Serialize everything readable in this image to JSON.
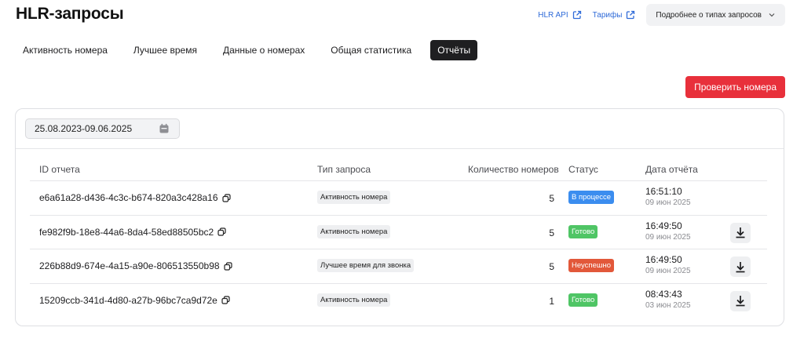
{
  "header": {
    "title": "HLR-запросы",
    "api_link": "HLR API",
    "tariffs_link": "Тарифы",
    "more_dropdown": "Подробнее о типах запросов",
    "link_color": "#2f6bd8"
  },
  "tabs": [
    {
      "label": "Активность номера",
      "active": false
    },
    {
      "label": "Лучшее время",
      "active": false
    },
    {
      "label": "Данные о номерах",
      "active": false
    },
    {
      "label": "Общая статистика",
      "active": false
    },
    {
      "label": "Отчёты",
      "active": true
    }
  ],
  "actions": {
    "check_numbers": "Проверить номера",
    "accent_color": "#e8303b"
  },
  "filter": {
    "date_range": "25.08.2023-09.06.2025",
    "icon": "calendar-icon"
  },
  "table": {
    "columns": {
      "id": "ID отчета",
      "type": "Тип запроса",
      "count": "Количество номеров",
      "status": "Статус",
      "date": "Дата отчёта"
    },
    "rows": [
      {
        "id": "e6a61a28-d436-4c3c-b674-820a3c428a16",
        "type": "Активность номера",
        "count": "5",
        "status": "В процессе",
        "status_color": "#3b8def",
        "time": "16:51:10",
        "date": "09 июн 2025",
        "downloadable": false
      },
      {
        "id": "fe982f9b-18e8-44a6-8da4-58ed88505bc2",
        "type": "Активность номера",
        "count": "5",
        "status": "Готово",
        "status_color": "#4fc565",
        "time": "16:49:50",
        "date": "09 июн 2025",
        "downloadable": true
      },
      {
        "id": "226b88d9-674e-4a15-a90e-806513550b98",
        "type": "Лучшее время для звонка",
        "count": "5",
        "status": "Неуспешно",
        "status_color": "#e2583a",
        "time": "16:49:50",
        "date": "09 июн 2025",
        "downloadable": true
      },
      {
        "id": "15209ccb-341d-4d80-a27b-96bc7ca9d72e",
        "type": "Активность номера",
        "count": "1",
        "status": "Готово",
        "status_color": "#4fc565",
        "time": "08:43:43",
        "date": "03 июн 2025",
        "downloadable": true
      }
    ]
  }
}
